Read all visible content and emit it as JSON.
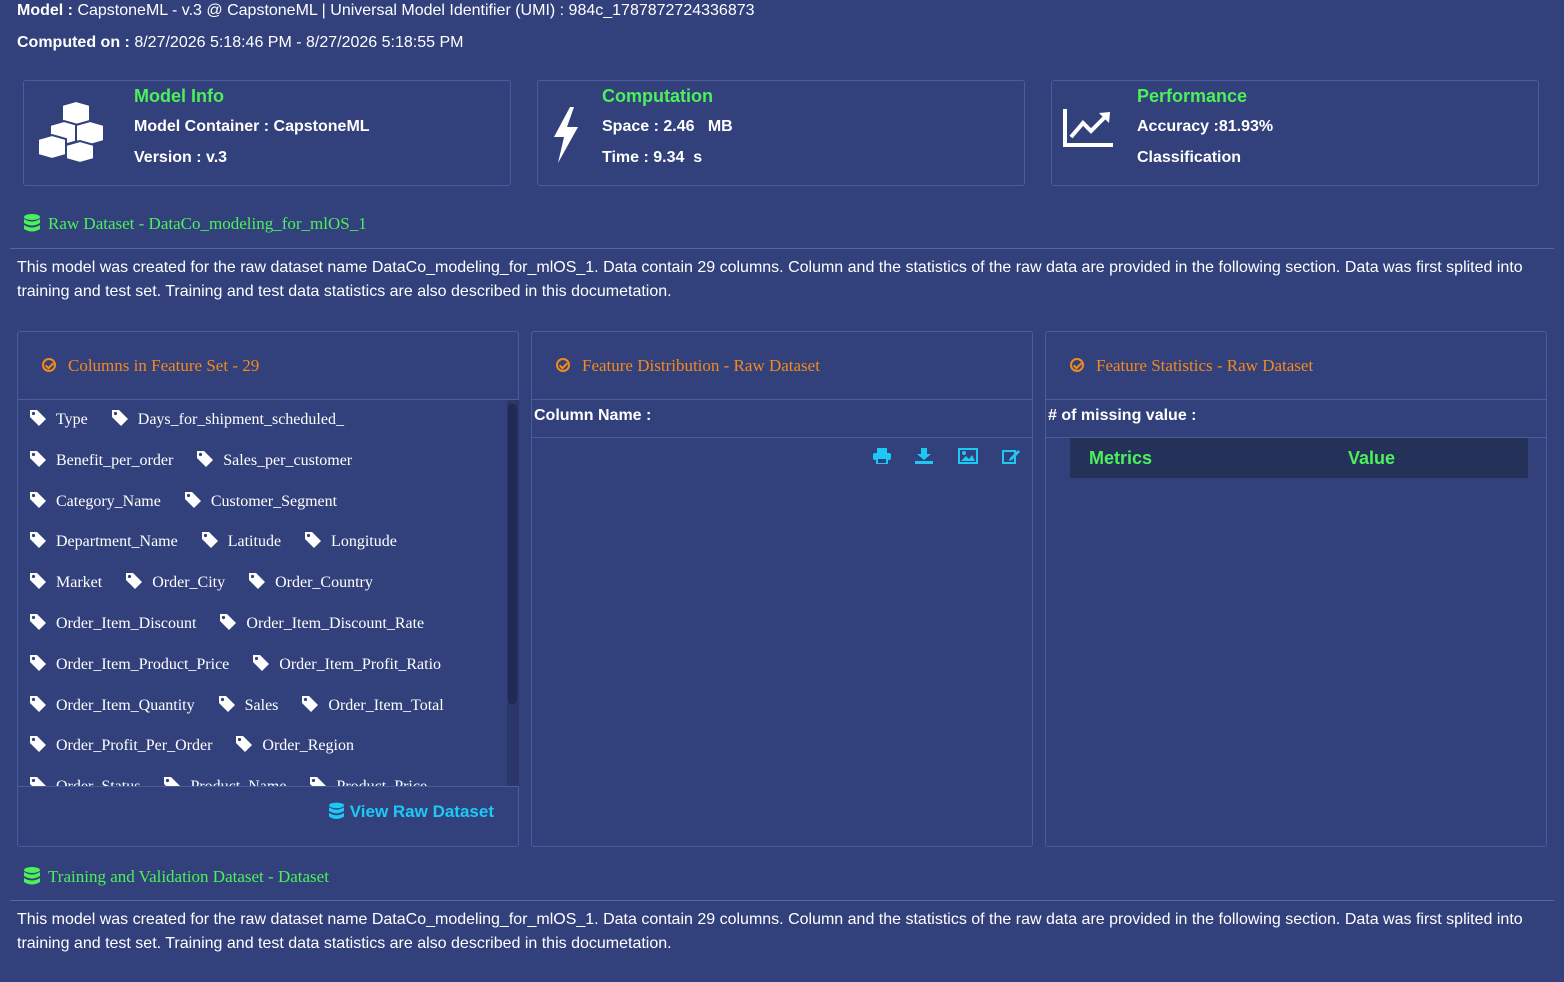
{
  "header": {
    "model_label": "Model :",
    "model_value": "CapstoneML - v.3 @ CapstoneML | Universal Model Identifier (UMI) : 984c_1787872724336873",
    "computed_label": "Computed on :",
    "computed_value": "8/27/2026 5:18:46 PM - 8/27/2026 5:18:55 PM"
  },
  "cards": {
    "model_info": {
      "title": "Model Info",
      "line1": "Model Container : CapstoneML",
      "line2": "Version : v.3",
      "icon": "cubes-icon"
    },
    "computation": {
      "title": "Computation",
      "line1": "Space : 2.46   MB",
      "line2": "Time : 9.34  s",
      "icon": "bolt-icon"
    },
    "performance": {
      "title": "Performance",
      "line1": "Accuracy :81.93%",
      "line2": "Classification",
      "icon": "line-chart-icon"
    }
  },
  "raw_section": {
    "title": "Raw Dataset - DataCo_modeling_for_mlOS_1",
    "description": "This model was created for the raw dataset name DataCo_modeling_for_mlOS_1. Data contain 29 columns. Column and the statistics of the raw data are provided in the following section. Data was first splited into training and test set. Training and test data statistics are also described in this documetation."
  },
  "panels": {
    "columns": {
      "title": "Columns in Feature Set - 29",
      "rows": [
        [
          "Type",
          "Days_for_shipment_scheduled_"
        ],
        [
          "Benefit_per_order",
          "Sales_per_customer"
        ],
        [
          "Category_Name",
          "Customer_Segment"
        ],
        [
          "Department_Name",
          "Latitude",
          "Longitude"
        ],
        [
          "Market",
          "Order_City",
          "Order_Country"
        ],
        [
          "Order_Item_Discount",
          "Order_Item_Discount_Rate"
        ],
        [
          "Order_Item_Product_Price",
          "Order_Item_Profit_Ratio"
        ],
        [
          "Order_Item_Quantity",
          "Sales",
          "Order_Item_Total"
        ],
        [
          "Order_Profit_Per_Order",
          "Order_Region"
        ],
        [
          "Order_Status",
          "Product_Name",
          "Product_Price"
        ]
      ],
      "button": "View Raw Dataset"
    },
    "distribution": {
      "title": "Feature Distribution - Raw Dataset",
      "subhead": "Column Name :",
      "tools": [
        "print-icon",
        "download-icon",
        "image-icon",
        "edit-icon"
      ]
    },
    "statistics": {
      "title": "Feature Statistics - Raw Dataset",
      "subhead": "# of missing value :",
      "col_metrics": "Metrics",
      "col_value": "Value"
    }
  },
  "train_section": {
    "title": "Training and Validation Dataset - Dataset",
    "description": "This model was created for the raw dataset name DataCo_modeling_for_mlOS_1. Data contain 29 columns. Column and the statistics of the raw data are provided in the following section. Data was first splited into training and test set. Training and test data statistics are also described in this documetation."
  },
  "colors": {
    "background": "#32417c",
    "accent_green": "#4cf05a",
    "accent_orange": "#f28a1c",
    "accent_cyan": "#1ec8f5"
  }
}
